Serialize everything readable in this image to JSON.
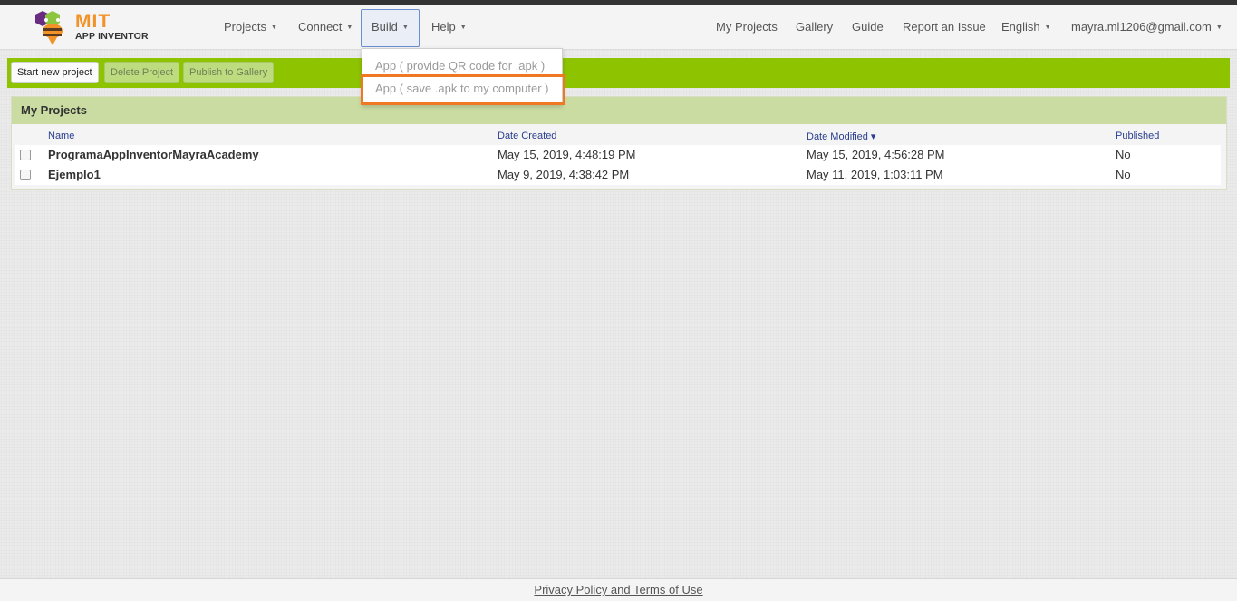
{
  "brand": {
    "title": "MIT",
    "subtitle": "APP INVENTOR"
  },
  "nav": {
    "projects": "Projects",
    "connect": "Connect",
    "build": "Build",
    "help": "Help",
    "my_projects": "My Projects",
    "gallery": "Gallery",
    "guide": "Guide",
    "report": "Report an Issue",
    "language": "English",
    "account": "mayra.ml1206@gmail.com"
  },
  "build_menu": {
    "items": [
      "App ( provide QR code for .apk )",
      "App ( save .apk to my computer )"
    ]
  },
  "toolbar": {
    "start_new": "Start new project",
    "delete": "Delete Project",
    "publish": "Publish to Gallery"
  },
  "projects_panel": {
    "title": "My Projects",
    "columns": {
      "name": "Name",
      "date_created": "Date Created",
      "date_modified": "Date Modified ▾",
      "published": "Published"
    },
    "rows": [
      {
        "name": "ProgramaAppInventorMayraAcademy",
        "date_created": "May 15, 2019, 4:48:19 PM",
        "date_modified": "May 15, 2019, 4:56:28 PM",
        "published": "No"
      },
      {
        "name": "Ejemplo1",
        "date_created": "May 9, 2019, 4:38:42 PM",
        "date_modified": "May 11, 2019, 1:03:11 PM",
        "published": "No"
      }
    ]
  },
  "footer": {
    "privacy": "Privacy Policy and Terms of Use"
  },
  "colors": {
    "toolbar_green": "#8ec300",
    "panel_header": "#cbdca2",
    "highlight_orange": "#f07822",
    "brand_orange": "#f29227",
    "link_blue": "#2a3e8f"
  },
  "icons": [
    "app-inventor-logo",
    "caret-down-icon",
    "checkbox"
  ]
}
